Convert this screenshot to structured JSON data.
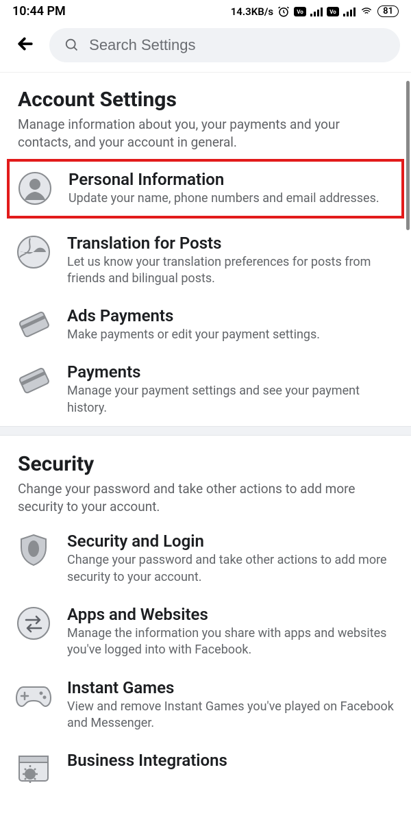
{
  "status": {
    "time": "10:44 PM",
    "speed": "14.3KB/s",
    "battery": "81"
  },
  "search": {
    "placeholder": "Search Settings"
  },
  "sections": {
    "account": {
      "title": "Account Settings",
      "subtitle": "Manage information about you, your payments and your contacts, and your account in general.",
      "items": [
        {
          "title": "Personal Information",
          "desc": "Update your name, phone numbers and email addresses."
        },
        {
          "title": "Translation for Posts",
          "desc": "Let us know your translation preferences for posts from friends and bilingual posts."
        },
        {
          "title": "Ads Payments",
          "desc": "Make payments or edit your payment settings."
        },
        {
          "title": "Payments",
          "desc": "Manage your payment settings and see your payment history."
        }
      ]
    },
    "security": {
      "title": "Security",
      "subtitle": "Change your password and take other actions to add more security to your account.",
      "items": [
        {
          "title": "Security and Login",
          "desc": "Change your password and take other actions to add more security to your account."
        },
        {
          "title": "Apps and Websites",
          "desc": "Manage the information you share with apps and websites you've logged into with Facebook."
        },
        {
          "title": "Instant Games",
          "desc": "View and remove Instant Games you've played on Facebook and Messenger."
        },
        {
          "title": "Business Integrations",
          "desc": ""
        }
      ]
    }
  }
}
